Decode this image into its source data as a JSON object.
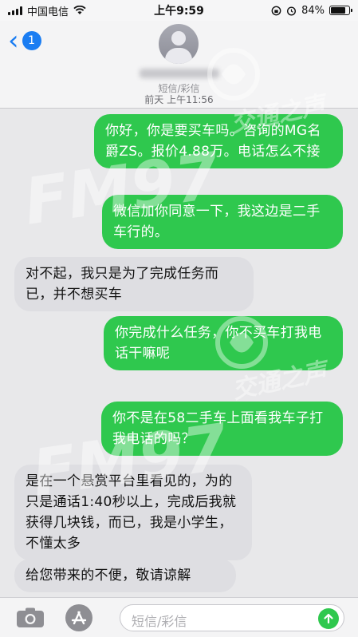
{
  "status_bar": {
    "carrier": "中国电信",
    "time": "上午9:59",
    "battery": "84%",
    "battery_level": 0.84
  },
  "nav": {
    "back_badge": "1",
    "contact_subtitle": "短信/彩信"
  },
  "thread": {
    "timestamp": "前天 上午11:56",
    "messages": [
      {
        "direction": "outgoing",
        "text": "你好，你是要买车吗。咨询的MG名爵ZS。报价4.88万。电话怎么不接"
      },
      {
        "direction": "outgoing",
        "text": "微信加你同意一下，我这边是二手车行的。"
      },
      {
        "direction": "incoming",
        "text": "对不起，我只是为了完成任务而已，并不想买车"
      },
      {
        "direction": "outgoing",
        "text": "你完成什么任务，你不买车打我电话干嘛呢"
      },
      {
        "direction": "outgoing",
        "text": "你不是在58二手车上面看我车子打我电话的吗？"
      },
      {
        "direction": "incoming",
        "text": "是在一个悬赏平台里看见的，为的只是通话1:40秒以上，完成后我就获得几块钱，而已，我是小学生，不懂太多"
      },
      {
        "direction": "incoming",
        "text": "给您带来的不便，敬请谅解"
      }
    ]
  },
  "watermark": {
    "logo_text": "FM97",
    "station_name": "交通之声"
  },
  "input": {
    "placeholder": "短信/彩信"
  },
  "colors": {
    "outgoing_bubble": "#2fc84e",
    "incoming_bubble": "#dedee2",
    "accent": "#1a7df2"
  }
}
